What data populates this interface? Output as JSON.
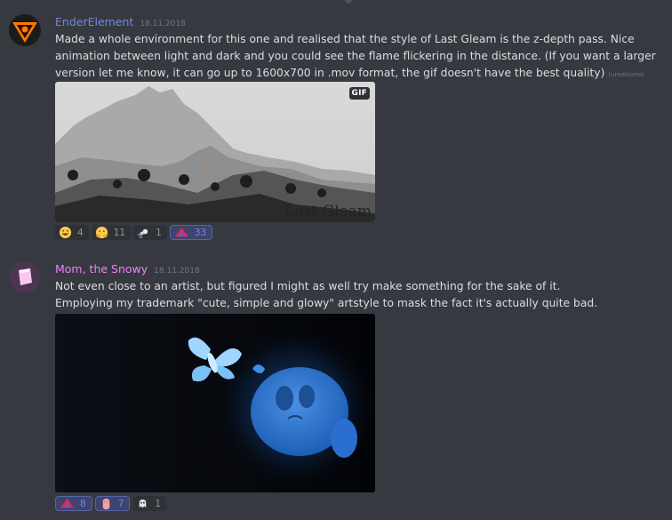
{
  "messages": [
    {
      "author": "EnderElement",
      "author_color": "#7289da",
      "timestamp": "18.11.2018",
      "text": "Made a whole environment for this one and realised that the style of Last Gleam is the z-depth pass. Nice animation between light and dark and you could see the flame flickering in the distance. (If you want a larger version let me know, it can go up to 1600x700 in .mov format, the gif doesn't have the best quality)",
      "edited": "(uredivano)",
      "attachment": {
        "badge": "GIF",
        "caption": "Last Gleam"
      },
      "reactions": [
        {
          "icon": "smiley-emoji-icon",
          "count": "4",
          "me": false
        },
        {
          "icon": "hugging-emoji-icon",
          "count": "11",
          "me": false
        },
        {
          "icon": "dash-emoji-icon",
          "count": "1",
          "me": false
        },
        {
          "icon": "red-triangle-emoji-icon",
          "count": "33",
          "me": true
        }
      ]
    },
    {
      "author": "Mom, the Snowy",
      "author_color": "#f47fff",
      "timestamp": "18.11.2018",
      "text_lines": [
        "Not even close to an artist, but figured I might as well try make something for the sake of it.",
        "Employing my trademark \"cute, simple and glowy\" artstyle to mask the fact it's actually quite bad."
      ],
      "reactions": [
        {
          "icon": "red-triangle-emoji-icon",
          "count": "8",
          "me": true
        },
        {
          "icon": "pink-hand-emoji-icon",
          "count": "7",
          "me": true
        },
        {
          "icon": "ghost-emoji-icon",
          "count": "1",
          "me": false
        }
      ]
    }
  ]
}
